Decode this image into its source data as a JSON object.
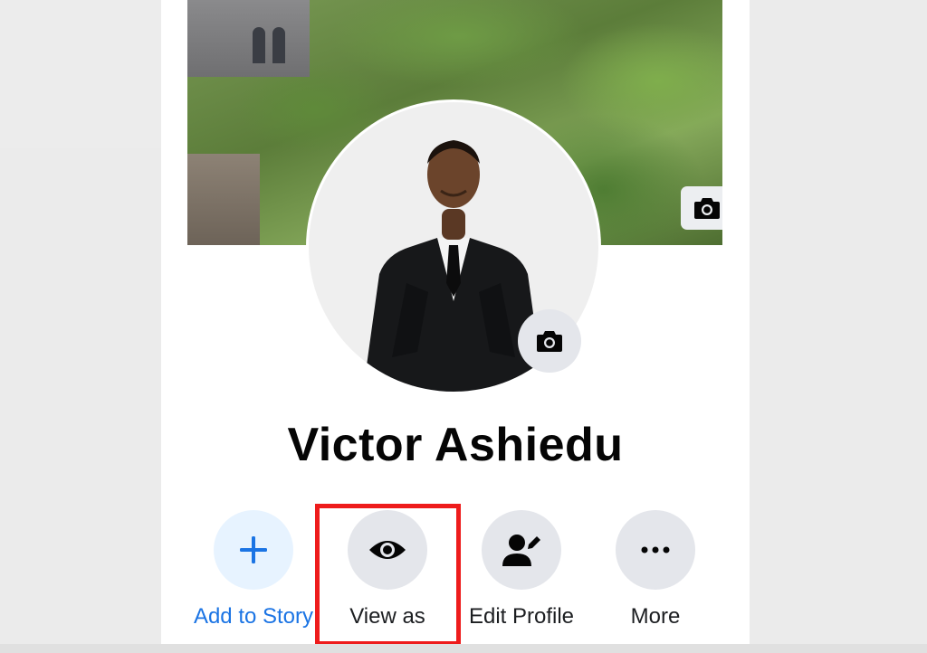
{
  "profile": {
    "name": "Victor Ashiedu"
  },
  "actions": [
    {
      "label": "Add to Story",
      "icon": "plus-icon",
      "color": "#1b74e4"
    },
    {
      "label": "View as",
      "icon": "eye-icon",
      "highlighted": true
    },
    {
      "label": "Edit Profile",
      "icon": "edit-profile-icon"
    },
    {
      "label": "More",
      "icon": "more-dots-icon"
    }
  ],
  "colors": {
    "highlight": "#ee1c1c",
    "accent": "#1b74e4",
    "button_bg": "#e4e6eb"
  }
}
